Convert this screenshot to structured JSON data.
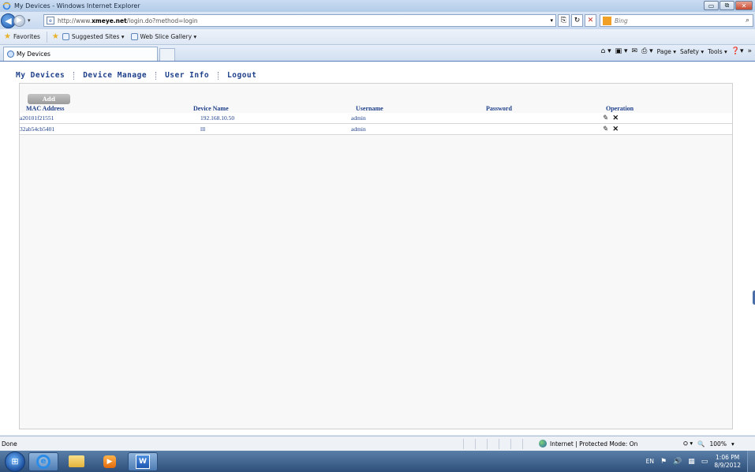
{
  "window": {
    "title": "My Devices - Windows Internet Explorer",
    "minimize_label": "▭",
    "maximize_label": "⧉",
    "close_label": "✕"
  },
  "address": {
    "url_prefix": "http://www.",
    "url_domain": "xmeye.net",
    "url_path": "/login.do?method=login",
    "search_placeholder": "Bing"
  },
  "favorites": {
    "favorites_label": "Favorites",
    "items": [
      "Suggested Sites ▾",
      "Web Slice Gallery ▾"
    ]
  },
  "tabs": [
    {
      "label": "My Devices"
    }
  ],
  "commandbar": {
    "page_label": "Page ▾",
    "safety_label": "Safety ▾",
    "tools_label": "Tools ▾"
  },
  "nav": {
    "items": [
      {
        "label": "My Devices"
      },
      {
        "label": "Device Manage"
      },
      {
        "label": "User Info"
      },
      {
        "label": "Logout"
      }
    ]
  },
  "devices": {
    "add_label": "Add",
    "columns": [
      "MAC Address",
      "Device Name",
      "Username",
      "Password",
      "Operation"
    ],
    "rows": [
      {
        "mac": "a20101f21551",
        "name": "192.168.10.50",
        "username": "admin",
        "password": ""
      },
      {
        "mac": "32ab54cb5401",
        "name": "lll",
        "username": "admin",
        "password": ""
      }
    ]
  },
  "icons": {
    "edit": "edit-icon",
    "delete": "delete-icon"
  },
  "status": {
    "left_text": "Done",
    "zone_text": "Internet | Protected Mode: On",
    "zoom_text": "100%"
  },
  "taskbar": {
    "language": "EN",
    "time": "1:06 PM",
    "date": "8/9/2012"
  },
  "colors": {
    "link_blue": "#1e3f8a",
    "panel_bg": "#f8f8f8",
    "add_button": "#9a9a9a"
  }
}
